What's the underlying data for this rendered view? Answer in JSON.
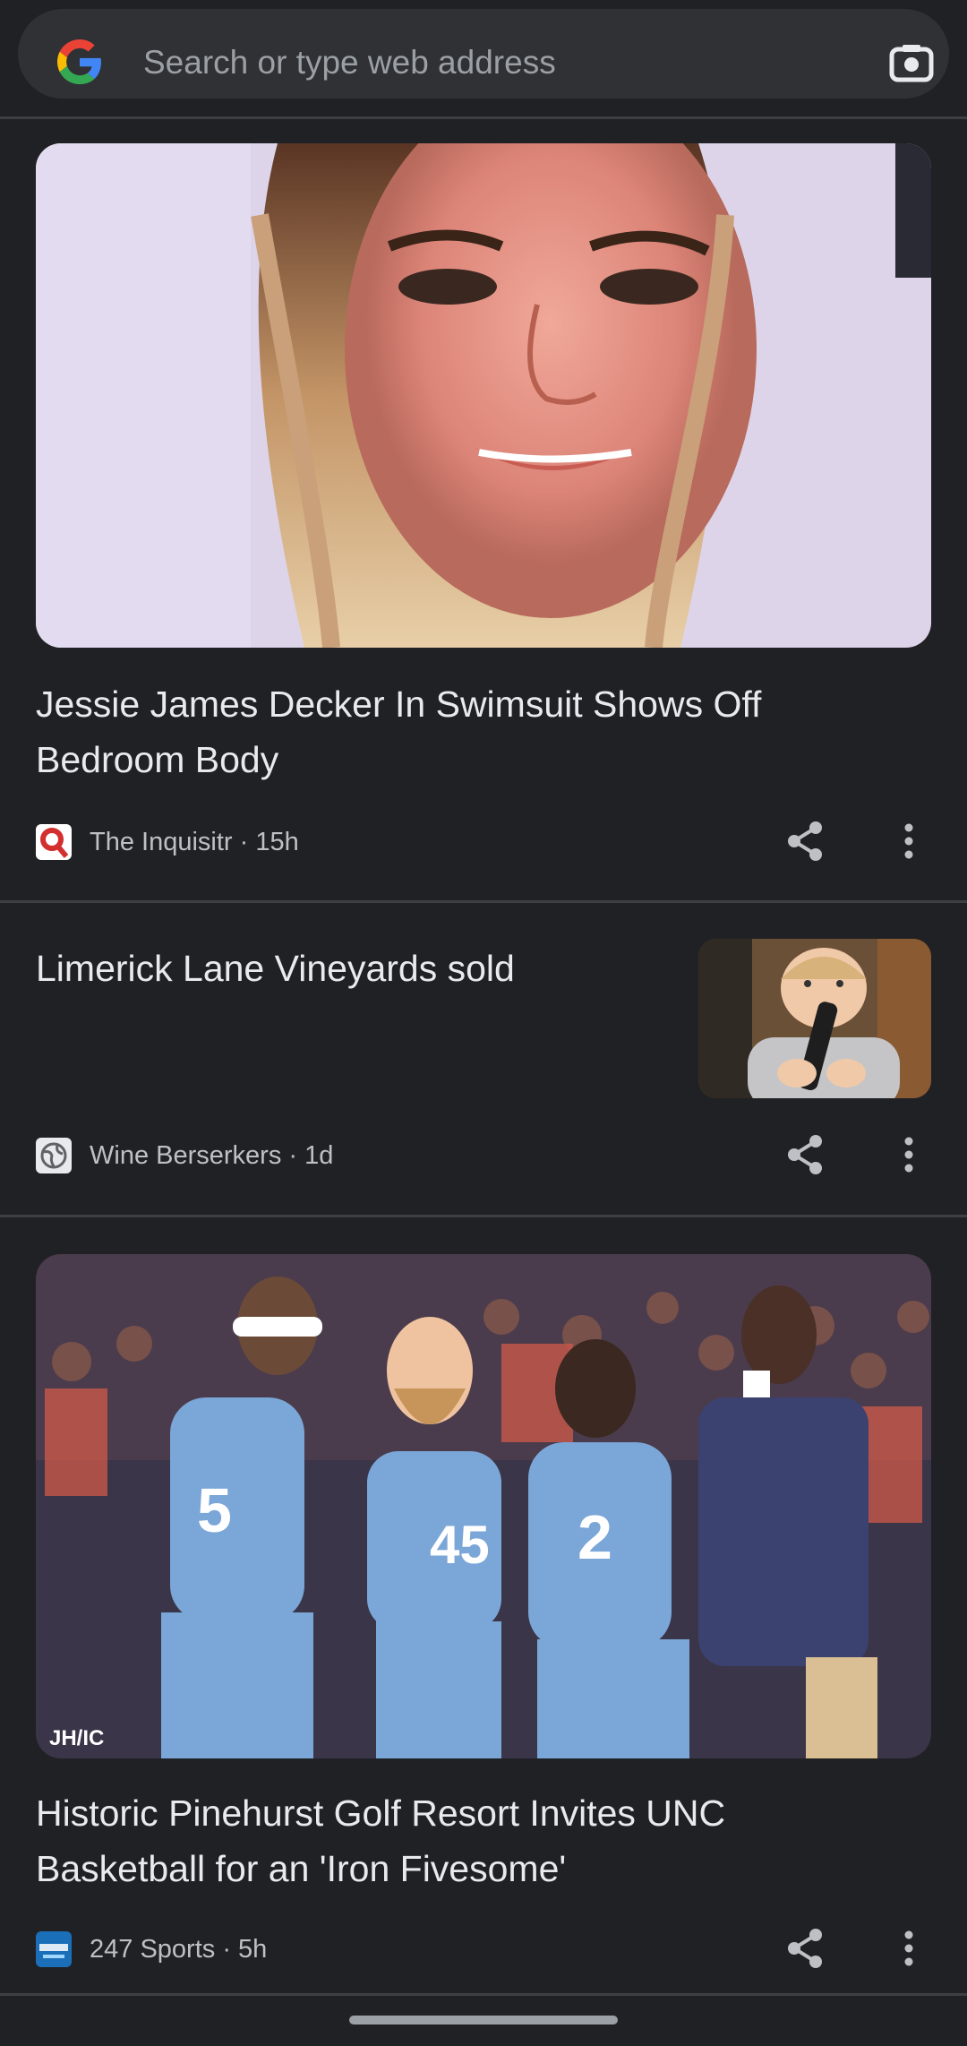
{
  "search": {
    "placeholder": "Search or type web address"
  },
  "icons": {
    "left": "google-g-icon",
    "right": "camera-icon"
  },
  "cards": [
    {
      "headline": "Jessie James Decker In Swimsuit Shows Off Bedroom Body",
      "source": "The Inquisitr · 15h",
      "logo": "inquisitr-logo",
      "image": "portrait-photo"
    },
    {
      "headline": "Limerick Lane Vineyards sold",
      "source": "Wine Berserkers · 1d",
      "logo": "globe-icon",
      "image": "child-with-bottle-photo"
    },
    {
      "headline": "Historic Pinehurst Golf Resort Invites UNC Basketball for an 'Iron Fivesome'",
      "source": "247 Sports · 5h",
      "logo": "247-sports-logo",
      "image": "basketball-team-photo",
      "watermark": "JH/IC"
    }
  ],
  "colors": {
    "background": "#202124",
    "searchbox": "#303134",
    "text": "#e8eaed",
    "secondary_text": "#bdc1c6"
  }
}
